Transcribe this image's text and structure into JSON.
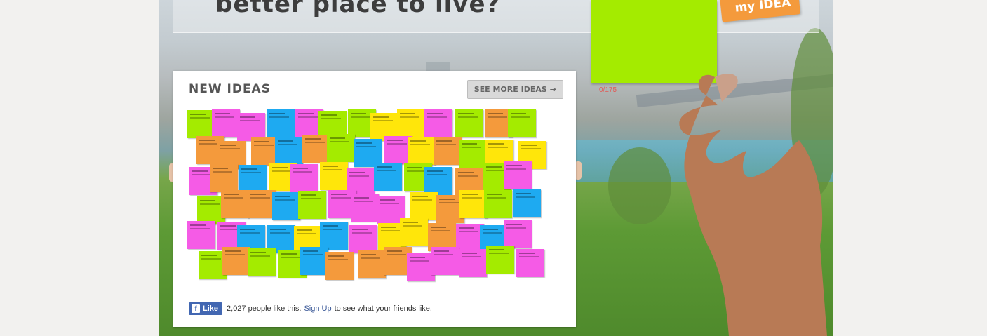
{
  "header": {
    "headline": "better place to live?"
  },
  "new_ideas": {
    "title": "NEW IDEAS",
    "see_more_label": "SEE MORE IDEAS",
    "see_more_icon": "arrow-right-icon"
  },
  "facebook": {
    "like_label": "Like",
    "like_icon": "facebook-icon",
    "count_text": "2,027 people like this.",
    "signup_label": "Sign Up",
    "suffix_text": "to see what your friends like."
  },
  "idea_input": {
    "counter": "0/175",
    "submit_label": "my IDEA"
  },
  "colors": {
    "green": "#a4eb00",
    "orange": "#f49a3c",
    "magenta": "#f55be6",
    "blue": "#1eaaf1",
    "yellow": "#ffe60a",
    "counter_red": "#e05a56",
    "fb_blue": "#4267b2"
  }
}
